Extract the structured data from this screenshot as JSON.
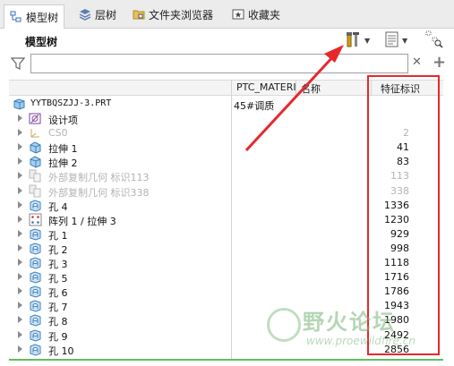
{
  "tabs": [
    {
      "label": "模型树",
      "icon": "model-tree-icon",
      "active": true
    },
    {
      "label": "层树",
      "icon": "layer-tree-icon",
      "active": false
    },
    {
      "label": "文件夹浏览器",
      "icon": "folder-browser-icon",
      "active": false
    },
    {
      "label": "收藏夹",
      "icon": "favorites-icon",
      "active": false
    }
  ],
  "panel": {
    "title": "模型树"
  },
  "search": {
    "value": "",
    "placeholder": ""
  },
  "columns": {
    "material": "PTC_MATERI",
    "name": "名称",
    "feature_id": "特征标识"
  },
  "root": {
    "name": "YYTBQSZJJ-3.PRT",
    "material": "45#调质"
  },
  "rows": [
    {
      "name": "设计项",
      "id": "",
      "icon": "design-item-icon",
      "dim": false
    },
    {
      "name": "CS0",
      "id": "2",
      "icon": "coordinate-system-icon",
      "dim": true
    },
    {
      "name": "拉伸 1",
      "id": "41",
      "icon": "extrude-icon",
      "dim": false
    },
    {
      "name": "拉伸 2",
      "id": "83",
      "icon": "extrude-icon",
      "dim": false
    },
    {
      "name": "外部复制几何 标识113",
      "id": "113",
      "icon": "external-copy-geom-icon",
      "dim": true
    },
    {
      "name": "外部复制几何 标识338",
      "id": "338",
      "icon": "external-copy-geom-icon",
      "dim": true
    },
    {
      "name": "孔 4",
      "id": "1336",
      "icon": "hole-icon",
      "dim": false
    },
    {
      "name": "阵列 1 / 拉伸 3",
      "id": "1230",
      "icon": "pattern-icon",
      "dim": false
    },
    {
      "name": "孔 1",
      "id": "929",
      "icon": "hole-icon",
      "dim": false
    },
    {
      "name": "孔 2",
      "id": "998",
      "icon": "hole-icon",
      "dim": false
    },
    {
      "name": "孔 3",
      "id": "1118",
      "icon": "hole-icon",
      "dim": false
    },
    {
      "name": "孔 5",
      "id": "1716",
      "icon": "hole-icon",
      "dim": false
    },
    {
      "name": "孔 6",
      "id": "1786",
      "icon": "hole-icon",
      "dim": false
    },
    {
      "name": "孔 7",
      "id": "1943",
      "icon": "hole-icon",
      "dim": false
    },
    {
      "name": "孔 8",
      "id": "1980",
      "icon": "hole-icon",
      "dim": false
    },
    {
      "name": "孔 9",
      "id": "2492",
      "icon": "hole-icon",
      "dim": false
    },
    {
      "name": "孔 10",
      "id": "2856",
      "icon": "hole-icon",
      "dim": false
    }
  ],
  "watermark": {
    "text": "野火论坛",
    "url": "www.proewildfire.cn"
  },
  "colors": {
    "highlight_box": "#e6282d",
    "accent_green": "#5fbf5f"
  }
}
